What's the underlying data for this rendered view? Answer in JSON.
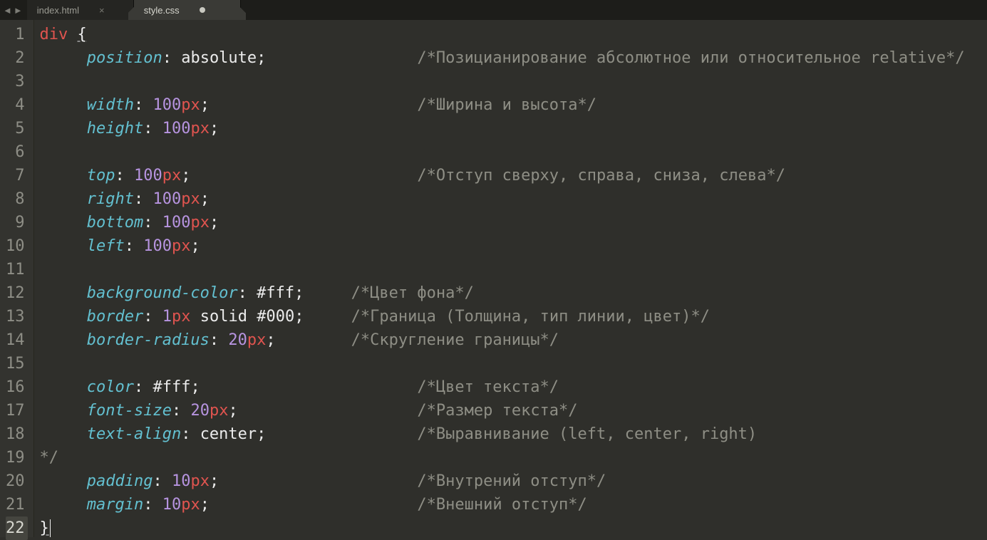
{
  "nav": {
    "back": "◄",
    "forward": "►"
  },
  "tabs": [
    {
      "title": "index.html",
      "active": false,
      "dirty": false
    },
    {
      "title": "style.css",
      "active": true,
      "dirty": true
    }
  ],
  "close_glyph": "×",
  "code": {
    "lines": [
      {
        "n": 1,
        "tokens": [
          {
            "t": "tag",
            "s": "div"
          },
          {
            "t": "punc",
            "s": " "
          },
          {
            "t": "punc",
            "s": "{",
            "cls": "underline"
          }
        ]
      },
      {
        "n": 2,
        "indent": 1,
        "tokens": [
          {
            "t": "prop",
            "s": "position"
          },
          {
            "t": "punc",
            "s": ": "
          },
          {
            "t": "kw",
            "s": "absolute"
          },
          {
            "t": "punc",
            "s": ";"
          }
        ],
        "comment_col": 40,
        "comment": "/*Позицианирование абсолютное или относительное relative*/"
      },
      {
        "n": 3,
        "tokens": []
      },
      {
        "n": 4,
        "indent": 1,
        "tokens": [
          {
            "t": "prop",
            "s": "width"
          },
          {
            "t": "punc",
            "s": ": "
          },
          {
            "t": "num",
            "s": "100"
          },
          {
            "t": "unit",
            "s": "px"
          },
          {
            "t": "punc",
            "s": ";"
          }
        ],
        "comment_col": 40,
        "comment": "/*Ширина и высота*/"
      },
      {
        "n": 5,
        "indent": 1,
        "tokens": [
          {
            "t": "prop",
            "s": "height"
          },
          {
            "t": "punc",
            "s": ": "
          },
          {
            "t": "num",
            "s": "100"
          },
          {
            "t": "unit",
            "s": "px"
          },
          {
            "t": "punc",
            "s": ";"
          }
        ]
      },
      {
        "n": 6,
        "tokens": []
      },
      {
        "n": 7,
        "indent": 1,
        "tokens": [
          {
            "t": "prop",
            "s": "top"
          },
          {
            "t": "punc",
            "s": ": "
          },
          {
            "t": "num",
            "s": "100"
          },
          {
            "t": "unit",
            "s": "px"
          },
          {
            "t": "punc",
            "s": ";"
          }
        ],
        "comment_col": 40,
        "comment": "/*Отступ сверху, справа, сниза, слева*/"
      },
      {
        "n": 8,
        "indent": 1,
        "tokens": [
          {
            "t": "prop",
            "s": "right"
          },
          {
            "t": "punc",
            "s": ": "
          },
          {
            "t": "num",
            "s": "100"
          },
          {
            "t": "unit",
            "s": "px"
          },
          {
            "t": "punc",
            "s": ";"
          }
        ]
      },
      {
        "n": 9,
        "indent": 1,
        "tokens": [
          {
            "t": "prop",
            "s": "bottom"
          },
          {
            "t": "punc",
            "s": ": "
          },
          {
            "t": "num",
            "s": "100"
          },
          {
            "t": "unit",
            "s": "px"
          },
          {
            "t": "punc",
            "s": ";"
          }
        ]
      },
      {
        "n": 10,
        "indent": 1,
        "tokens": [
          {
            "t": "prop",
            "s": "left"
          },
          {
            "t": "punc",
            "s": ": "
          },
          {
            "t": "num",
            "s": "100"
          },
          {
            "t": "unit",
            "s": "px"
          },
          {
            "t": "punc",
            "s": ";"
          }
        ]
      },
      {
        "n": 11,
        "tokens": []
      },
      {
        "n": 12,
        "indent": 1,
        "tokens": [
          {
            "t": "prop",
            "s": "background-color"
          },
          {
            "t": "punc",
            "s": ": "
          },
          {
            "t": "hex",
            "s": "#fff"
          },
          {
            "t": "punc",
            "s": ";"
          }
        ],
        "comment_col": 33,
        "comment": "/*Цвет фона*/"
      },
      {
        "n": 13,
        "indent": 1,
        "tokens": [
          {
            "t": "prop",
            "s": "border"
          },
          {
            "t": "punc",
            "s": ": "
          },
          {
            "t": "num",
            "s": "1"
          },
          {
            "t": "unit",
            "s": "px"
          },
          {
            "t": "punc",
            "s": " "
          },
          {
            "t": "kw",
            "s": "solid"
          },
          {
            "t": "punc",
            "s": " "
          },
          {
            "t": "hex",
            "s": "#000"
          },
          {
            "t": "punc",
            "s": ";"
          }
        ],
        "comment_col": 33,
        "comment": "/*Граница (Толщина, тип линии, цвет)*/"
      },
      {
        "n": 14,
        "indent": 1,
        "tokens": [
          {
            "t": "prop",
            "s": "border-radius"
          },
          {
            "t": "punc",
            "s": ": "
          },
          {
            "t": "num",
            "s": "20"
          },
          {
            "t": "unit",
            "s": "px"
          },
          {
            "t": "punc",
            "s": ";"
          }
        ],
        "comment_col": 33,
        "comment": "/*Скругление границы*/"
      },
      {
        "n": 15,
        "tokens": []
      },
      {
        "n": 16,
        "indent": 1,
        "tokens": [
          {
            "t": "prop",
            "s": "color"
          },
          {
            "t": "punc",
            "s": ": "
          },
          {
            "t": "hex",
            "s": "#fff"
          },
          {
            "t": "punc",
            "s": ";"
          }
        ],
        "comment_col": 40,
        "comment": "/*Цвет текста*/"
      },
      {
        "n": 17,
        "indent": 1,
        "tokens": [
          {
            "t": "prop",
            "s": "font-size"
          },
          {
            "t": "punc",
            "s": ": "
          },
          {
            "t": "num",
            "s": "20"
          },
          {
            "t": "unit",
            "s": "px"
          },
          {
            "t": "punc",
            "s": ";"
          }
        ],
        "comment_col": 40,
        "comment": "/*Размер текста*/"
      },
      {
        "n": 18,
        "indent": 1,
        "tokens": [
          {
            "t": "prop",
            "s": "text-align"
          },
          {
            "t": "punc",
            "s": ": "
          },
          {
            "t": "kw",
            "s": "center"
          },
          {
            "t": "punc",
            "s": ";"
          }
        ],
        "comment_col": 40,
        "comment": "/*Выравнивание (left, center, right)"
      },
      {
        "n": 19,
        "tokens": [
          {
            "t": "cmt",
            "s": "*/"
          }
        ]
      },
      {
        "n": 20,
        "indent": 1,
        "tokens": [
          {
            "t": "prop",
            "s": "padding"
          },
          {
            "t": "punc",
            "s": ": "
          },
          {
            "t": "num",
            "s": "10"
          },
          {
            "t": "unit",
            "s": "px"
          },
          {
            "t": "punc",
            "s": ";"
          }
        ],
        "comment_col": 40,
        "comment": "/*Внутрений отступ*/"
      },
      {
        "n": 21,
        "indent": 1,
        "tokens": [
          {
            "t": "prop",
            "s": "margin"
          },
          {
            "t": "punc",
            "s": ": "
          },
          {
            "t": "num",
            "s": "10"
          },
          {
            "t": "unit",
            "s": "px"
          },
          {
            "t": "punc",
            "s": ";"
          }
        ],
        "comment_col": 40,
        "comment": "/*Внешний отступ*/"
      },
      {
        "n": 22,
        "tokens": [
          {
            "t": "punc",
            "s": "}",
            "cls": "underline"
          }
        ],
        "caret": true
      }
    ],
    "current_line": 22
  }
}
